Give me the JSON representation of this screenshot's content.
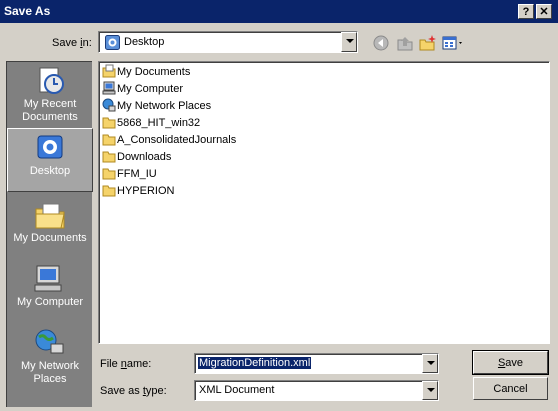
{
  "window": {
    "title": "Save As",
    "help_glyph": "?",
    "close_glyph": "✕"
  },
  "toolbar": {
    "save_in_prefix": "Save ",
    "save_in_underlined": "i",
    "save_in_suffix": "n:",
    "save_in_value": "Desktop",
    "icons": [
      "back-icon",
      "up-folder-icon",
      "new-folder-icon",
      "views-menu-icon"
    ]
  },
  "places": [
    {
      "label": "My Recent Documents",
      "icon": "recent-documents-icon"
    },
    {
      "label": "Desktop",
      "icon": "desktop-icon",
      "selected": true
    },
    {
      "label": "My Documents",
      "icon": "my-documents-icon"
    },
    {
      "label": "My Computer",
      "icon": "my-computer-icon"
    },
    {
      "label": "My Network Places",
      "icon": "network-places-icon"
    }
  ],
  "files": [
    {
      "name": "My Documents",
      "icon": "my-documents-icon"
    },
    {
      "name": "My Computer",
      "icon": "my-computer-icon"
    },
    {
      "name": "My Network Places",
      "icon": "network-places-icon"
    },
    {
      "name": "5868_HIT_win32",
      "icon": "folder-icon"
    },
    {
      "name": "A_ConsolidatedJournals",
      "icon": "folder-icon"
    },
    {
      "name": "Downloads",
      "icon": "folder-icon"
    },
    {
      "name": "FFM_IU",
      "icon": "folder-icon"
    },
    {
      "name": "HYPERION",
      "icon": "folder-icon"
    }
  ],
  "filename": {
    "label_prefix": "File ",
    "label_underlined": "n",
    "label_suffix": "ame:",
    "value": "MigrationDefinition.xml"
  },
  "filetype": {
    "label_prefix": "Save as ",
    "label_underlined": "t",
    "label_suffix": "ype:",
    "value": "XML Document"
  },
  "buttons": {
    "save": "Save",
    "save_underlined": "S",
    "save_rest": "ave",
    "cancel": "Cancel"
  },
  "colors": {
    "titlebar": "#0a246a",
    "dialog": "#d4d0c8",
    "places_bar": "#808080",
    "selection": "#0a246a"
  }
}
